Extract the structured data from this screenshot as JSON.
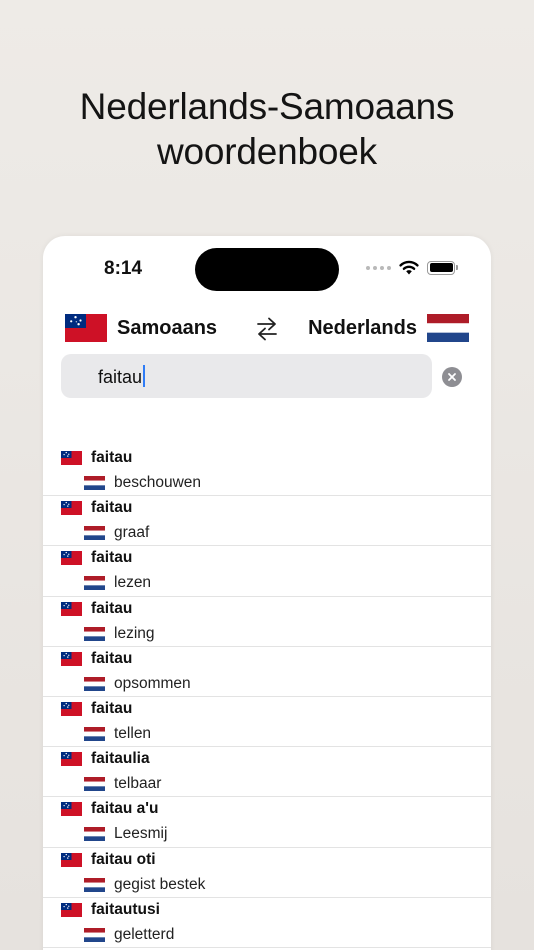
{
  "headline": {
    "line1": "Nederlands-Samoaans",
    "line2": "woordenboek"
  },
  "status_bar": {
    "time": "8:14"
  },
  "language_bar": {
    "source_language": "Samoaans",
    "target_language": "Nederlands",
    "source_flag": "samoa-flag",
    "target_flag": "netherlands-flag",
    "swap_icon": "swap-arrows-icon"
  },
  "search": {
    "value": "faitau",
    "clear_icon": "clear-icon"
  },
  "colors": {
    "accent": "#2f7cf6",
    "samoa_red": "#ce1126",
    "samoa_blue": "#002b7f",
    "nl_red": "#ae1c28",
    "nl_blue": "#21468b"
  },
  "results": [
    {
      "word": "faitau",
      "translation": "beschouwen"
    },
    {
      "word": "faitau",
      "translation": "graaf"
    },
    {
      "word": "faitau",
      "translation": "lezen"
    },
    {
      "word": "faitau",
      "translation": "lezing"
    },
    {
      "word": "faitau",
      "translation": "opsommen"
    },
    {
      "word": "faitau",
      "translation": "tellen"
    },
    {
      "word": "faitaulia",
      "translation": "telbaar"
    },
    {
      "word": "faitau a'u",
      "translation": "Leesmij"
    },
    {
      "word": "faitau oti",
      "translation": "gegist bestek"
    },
    {
      "word": "faitautusi",
      "translation": "geletterd"
    }
  ]
}
